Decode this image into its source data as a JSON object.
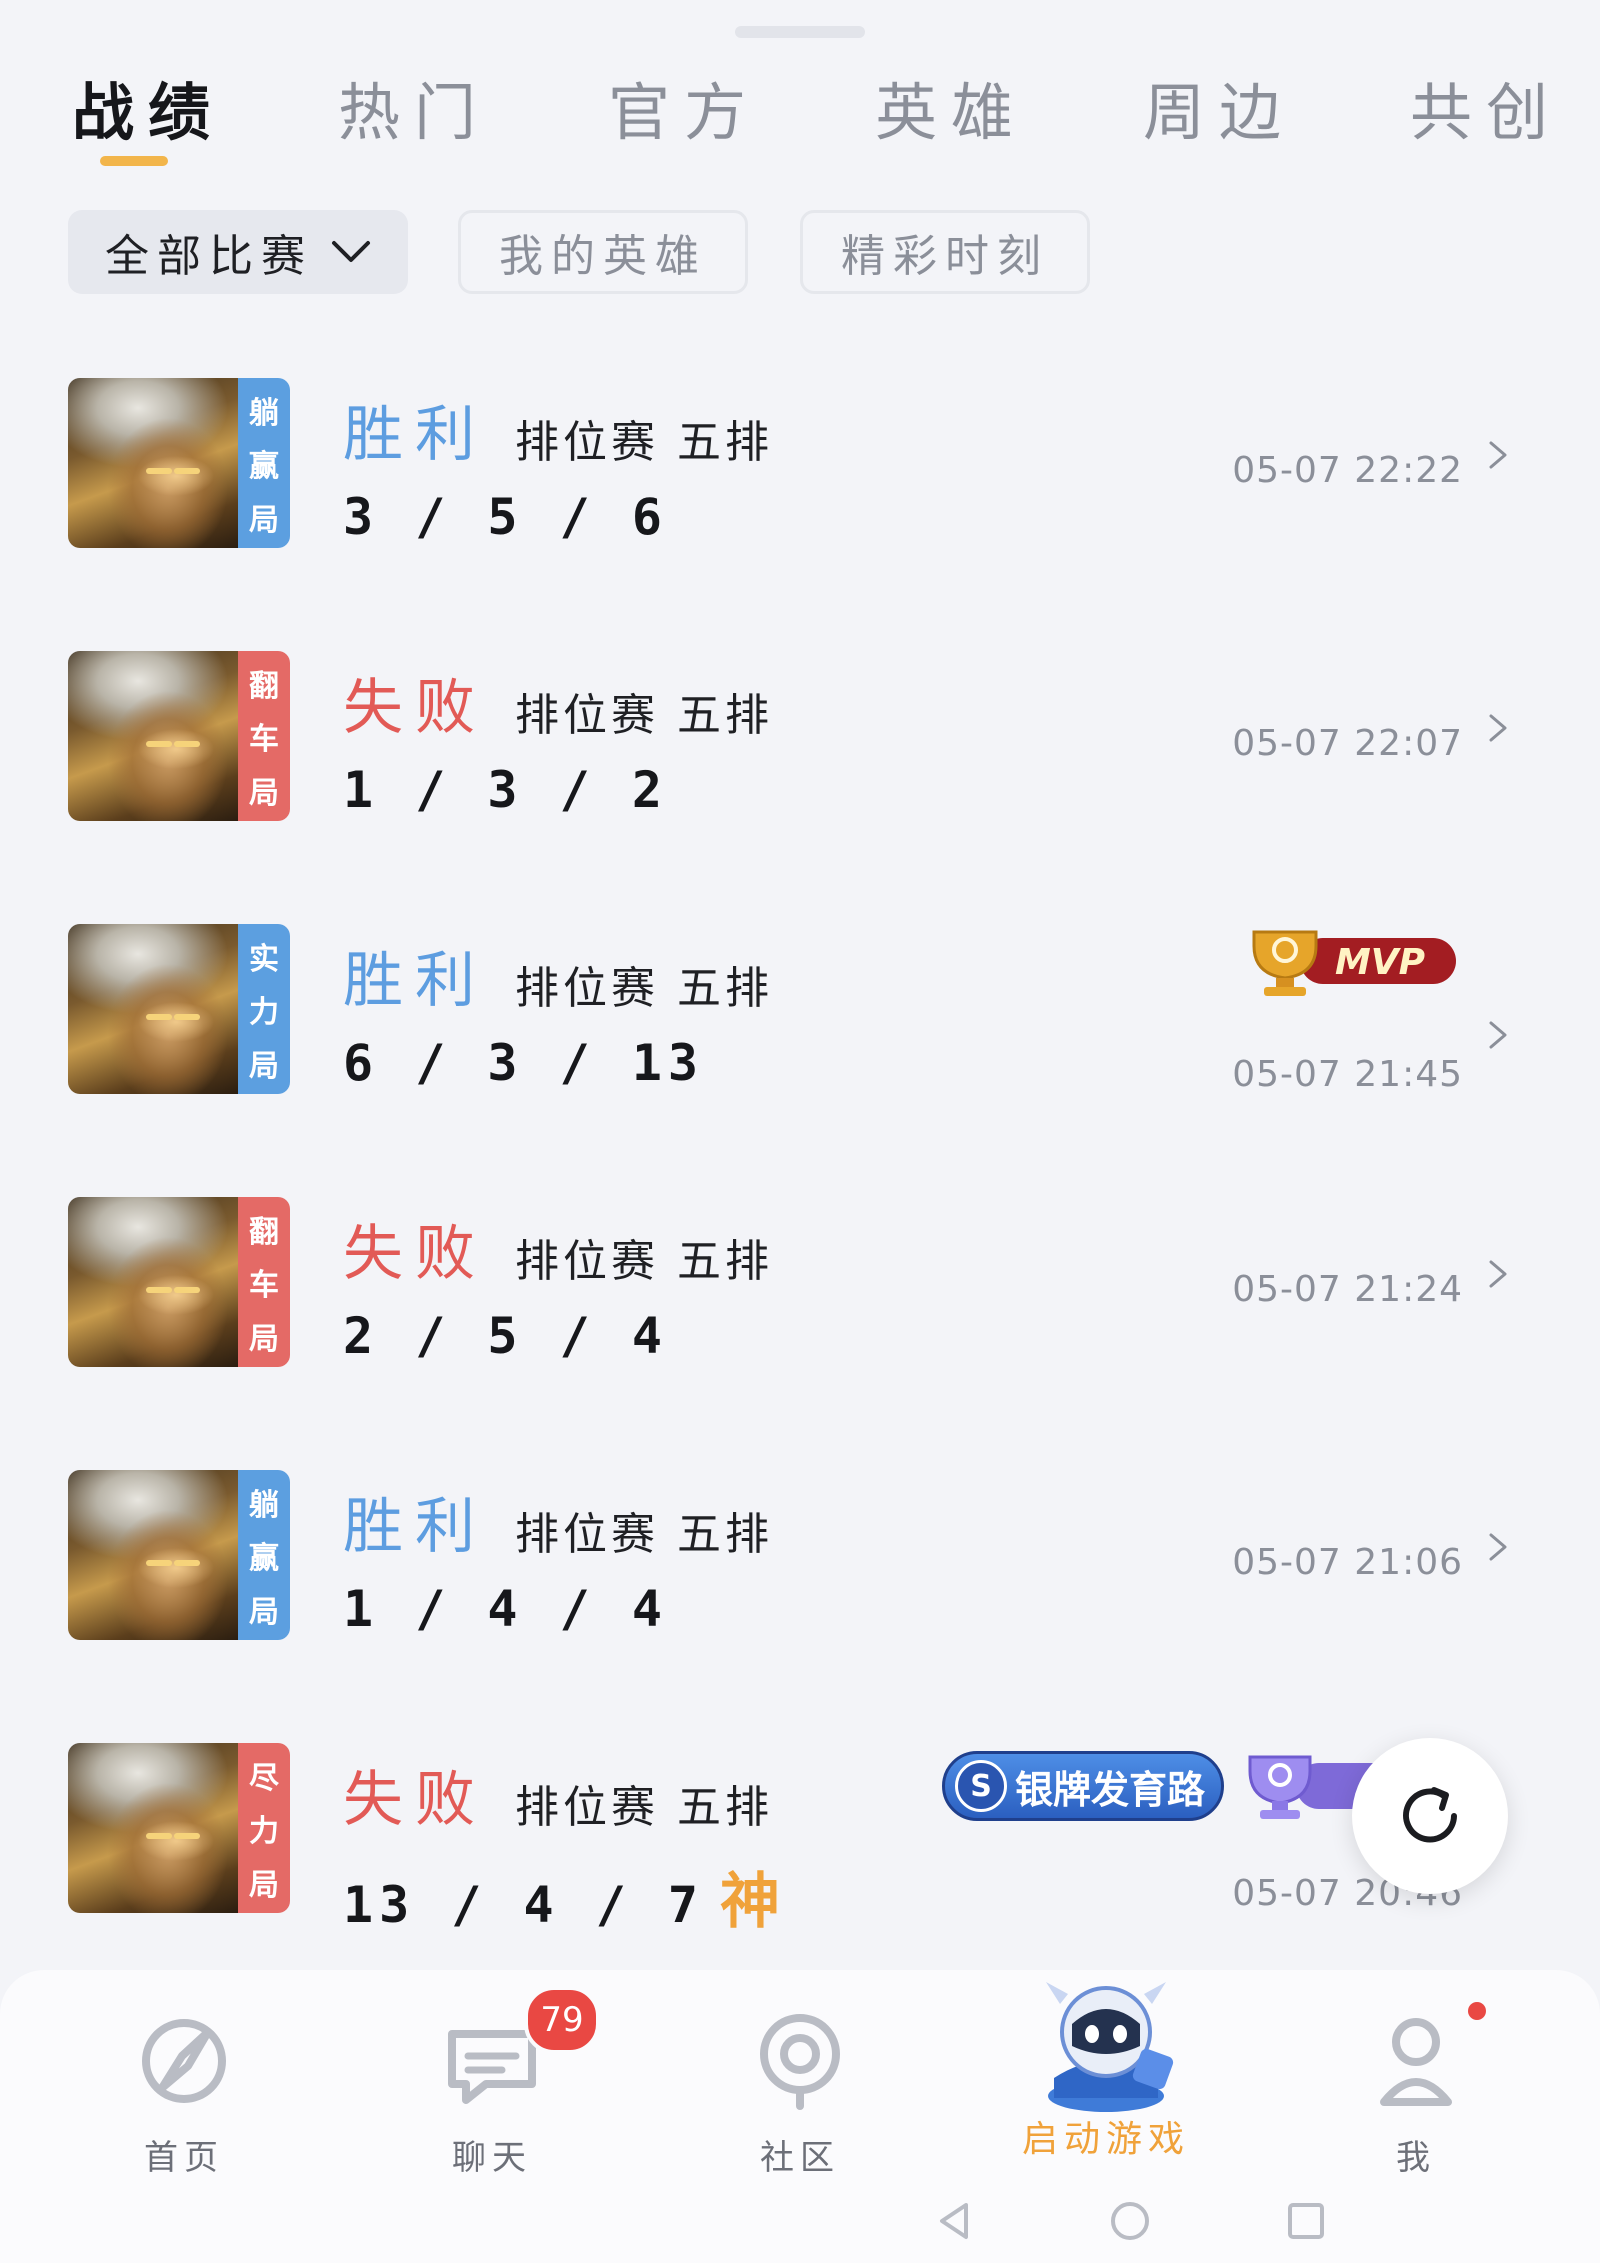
{
  "tabs": [
    {
      "label": "战绩",
      "active": true
    },
    {
      "label": "热门"
    },
    {
      "label": "官方"
    },
    {
      "label": "英雄"
    },
    {
      "label": "周边"
    },
    {
      "label": "共创"
    }
  ],
  "filters": {
    "all_matches": "全部比赛",
    "my_heroes": "我的英雄",
    "highlights": "精彩时刻"
  },
  "matches": [
    {
      "tag": [
        "躺",
        "赢",
        "局"
      ],
      "tag_color": "#5c9fe0",
      "result": "胜利",
      "mode": "排位赛 五排",
      "kda": "3 / 5 / 6",
      "time": "05-07 22:22"
    },
    {
      "tag": [
        "翻",
        "车",
        "局"
      ],
      "tag_color": "#e46a66",
      "result": "失败",
      "mode": "排位赛 五排",
      "kda": "1 / 3 / 2",
      "time": "05-07 22:07"
    },
    {
      "tag": [
        "实",
        "力",
        "局"
      ],
      "tag_color": "#5c9fe0",
      "result": "胜利",
      "mode": "排位赛 五排",
      "kda": "6 / 3 / 13",
      "time": "05-07 21:45",
      "badge": "MVP"
    },
    {
      "tag": [
        "翻",
        "车",
        "局"
      ],
      "tag_color": "#e46a66",
      "result": "失败",
      "mode": "排位赛 五排",
      "kda": "2 / 5 / 4",
      "time": "05-07 21:24"
    },
    {
      "tag": [
        "躺",
        "赢",
        "局"
      ],
      "tag_color": "#5c9fe0",
      "result": "胜利",
      "mode": "排位赛 五排",
      "kda": "1 / 4 / 4",
      "time": "05-07 21:06"
    },
    {
      "tag": [
        "尽",
        "力",
        "局"
      ],
      "tag_color": "#e46a66",
      "result": "失败",
      "mode": "排位赛 五排",
      "kda": "13 / 4 / 7",
      "god": "神",
      "time": "05-07 20:46",
      "badge_silver": "银牌发育路"
    }
  ],
  "nav": {
    "home": "首页",
    "chat": "聊天",
    "chat_count": "79",
    "community": "社区",
    "launch": "启动游戏",
    "me": "我"
  },
  "colors": {
    "win": "#5d9de0",
    "lose": "#e25a56",
    "accent": "#f2b54b",
    "badge_red": "#e94843"
  },
  "icons": {
    "refresh": "refresh-icon",
    "home": "compass-icon",
    "chat": "chat-bubble-icon",
    "community": "location-pin-icon",
    "launch": "robot-mascot-icon",
    "me": "person-icon"
  }
}
